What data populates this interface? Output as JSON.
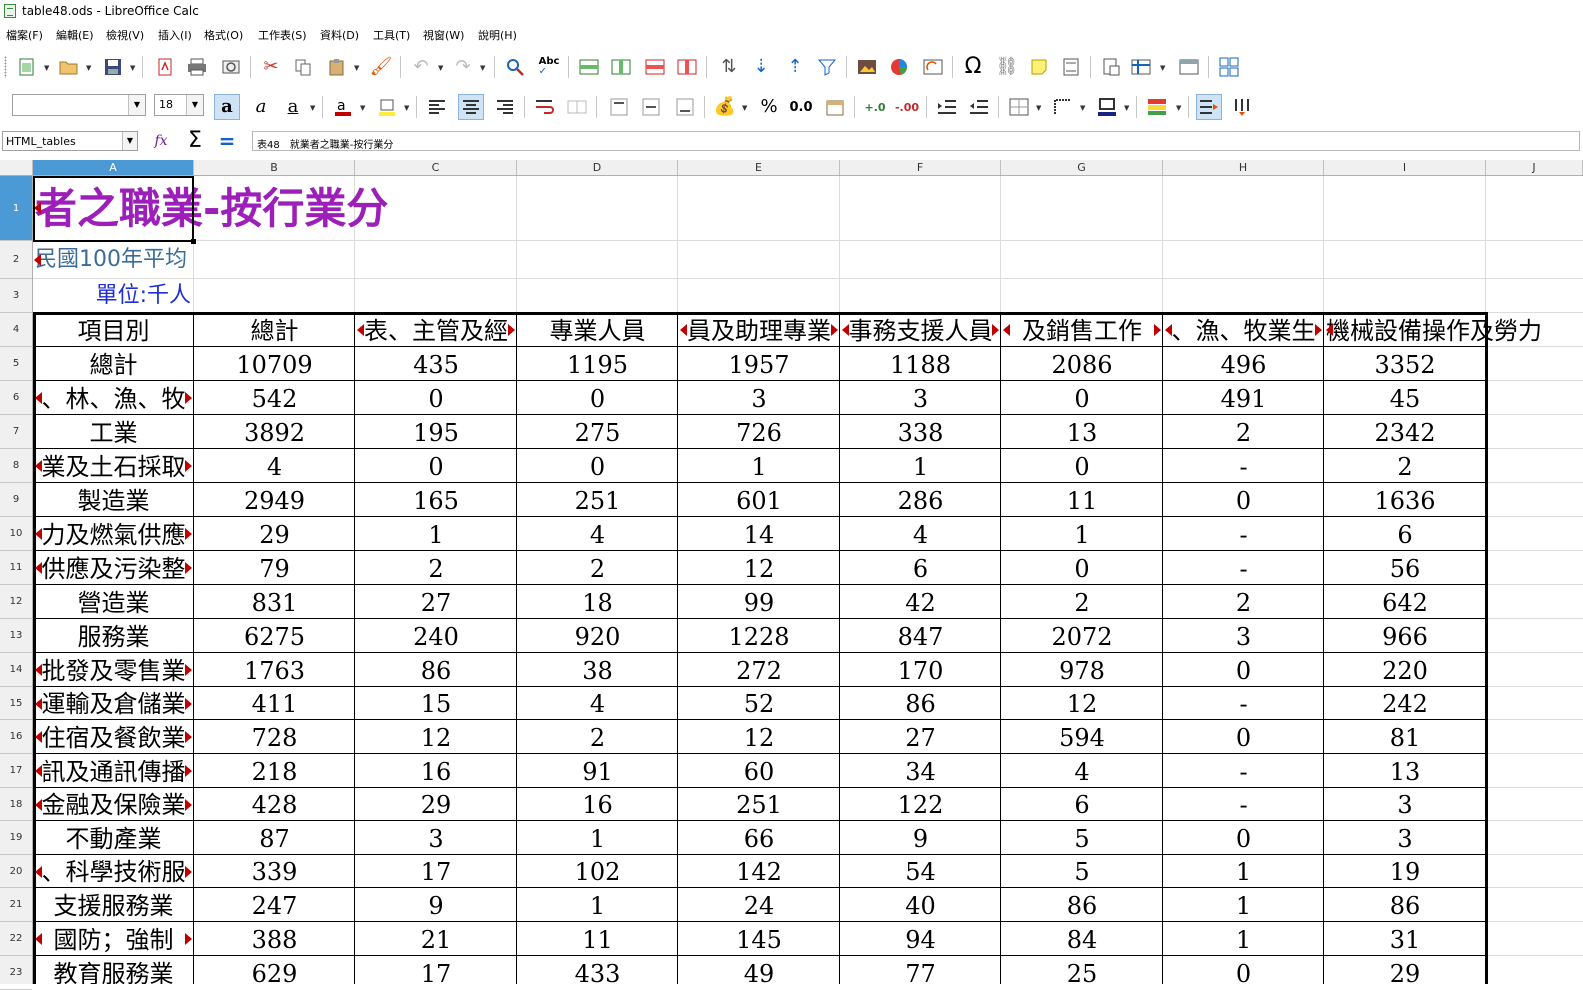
{
  "window": {
    "title": "table48.ods - LibreOffice Calc"
  },
  "menu": [
    "檔案(F)",
    "編輯(E)",
    "檢視(V)",
    "插入(I)",
    "格式(O)",
    "工作表(S)",
    "資料(D)",
    "工具(T)",
    "視窗(W)",
    "說明(H)"
  ],
  "formatting": {
    "font_name": "",
    "font_size": "18"
  },
  "formula_bar": {
    "name_box": "HTML_tables",
    "content": "表48　就業者之職業-按行業分"
  },
  "columns": [
    "A",
    "B",
    "C",
    "D",
    "E",
    "F",
    "G",
    "H",
    "I",
    "J"
  ],
  "rows": [
    "1",
    "2",
    "3",
    "4",
    "5",
    "6",
    "7",
    "8",
    "9",
    "10",
    "11",
    "12",
    "13",
    "14",
    "15",
    "16",
    "17",
    "18",
    "19",
    "20",
    "21",
    "22",
    "23"
  ],
  "sheet": {
    "title": "者之職業-按行業分",
    "subtitle": "民國100年平均",
    "unit": "單位:千人",
    "header": [
      "項目別",
      "總計",
      "表、主管及經",
      "專業人員",
      "員及助理專業",
      "事務支援人員",
      "及銷售工作",
      "、漁、牧業生",
      "機械設備操作及勞力"
    ],
    "data": [
      [
        "總計",
        "10709",
        "435",
        "1195",
        "1957",
        "1188",
        "2086",
        "496",
        "3352"
      ],
      [
        "、林、漁、牧",
        "542",
        "0",
        "0",
        "3",
        "3",
        "0",
        "491",
        "45"
      ],
      [
        "工業",
        "3892",
        "195",
        "275",
        "726",
        "338",
        "13",
        "2",
        "2342"
      ],
      [
        "業及土石採取",
        "4",
        "0",
        "0",
        "1",
        "1",
        "0",
        "-",
        "2"
      ],
      [
        "製造業",
        "2949",
        "165",
        "251",
        "601",
        "286",
        "11",
        "0",
        "1636"
      ],
      [
        "力及燃氣供應",
        "29",
        "1",
        "4",
        "14",
        "4",
        "1",
        "-",
        "6"
      ],
      [
        "供應及污染整",
        "79",
        "2",
        "2",
        "12",
        "6",
        "0",
        "-",
        "56"
      ],
      [
        "營造業",
        "831",
        "27",
        "18",
        "99",
        "42",
        "2",
        "2",
        "642"
      ],
      [
        "服務業",
        "6275",
        "240",
        "920",
        "1228",
        "847",
        "2072",
        "3",
        "966"
      ],
      [
        "批發及零售業",
        "1763",
        "86",
        "38",
        "272",
        "170",
        "978",
        "0",
        "220"
      ],
      [
        "運輸及倉儲業",
        "411",
        "15",
        "4",
        "52",
        "86",
        "12",
        "-",
        "242"
      ],
      [
        "住宿及餐飲業",
        "728",
        "12",
        "2",
        "12",
        "27",
        "594",
        "0",
        "81"
      ],
      [
        "訊及通訊傳播",
        "218",
        "16",
        "91",
        "60",
        "34",
        "4",
        "-",
        "13"
      ],
      [
        "金融及保險業",
        "428",
        "29",
        "16",
        "251",
        "122",
        "6",
        "-",
        "3"
      ],
      [
        "不動產業",
        "87",
        "3",
        "1",
        "66",
        "9",
        "5",
        "0",
        "3"
      ],
      [
        "、科學技術服",
        "339",
        "17",
        "102",
        "142",
        "54",
        "5",
        "1",
        "19"
      ],
      [
        "支援服務業",
        "247",
        "9",
        "1",
        "24",
        "40",
        "86",
        "1",
        "86"
      ],
      [
        "國防；強制",
        "388",
        "21",
        "11",
        "145",
        "94",
        "84",
        "1",
        "31"
      ],
      [
        "教育服務業",
        "629",
        "17",
        "433",
        "49",
        "77",
        "25",
        "0",
        "29"
      ]
    ]
  },
  "colors": {
    "title": "#9b1fb8",
    "subtitle": "#3b6c99",
    "unit": "#1f2fd8",
    "selection": "#4b9ad6"
  }
}
